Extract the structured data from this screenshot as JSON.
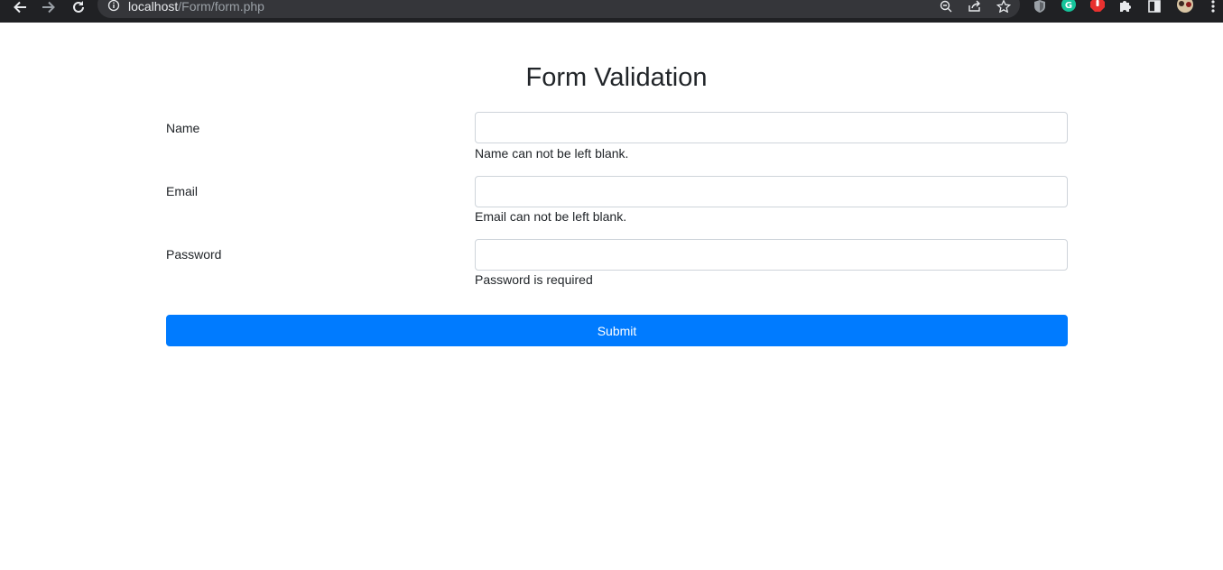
{
  "browser": {
    "url_host": "localhost",
    "url_path": "/Form/form.php",
    "icons": [
      "back-icon",
      "forward-icon",
      "reload-icon",
      "info-icon",
      "zoom-icon",
      "share-icon",
      "star-icon",
      "shield-extension-icon",
      "grammarly-icon",
      "stop-extension-icon",
      "puzzle-icon",
      "sidepanel-icon",
      "profile-avatar",
      "menu-icon"
    ],
    "colors": {
      "bar": "#202124",
      "omnibox": "#35363a",
      "grammarly": "#15c39a",
      "stop_ext": "#e8312f"
    }
  },
  "page": {
    "title": "Form Validation",
    "fields": [
      {
        "label": "Name",
        "value": "",
        "error": "Name can not be left blank."
      },
      {
        "label": "Email",
        "value": "",
        "error": "Email can not be left blank."
      },
      {
        "label": "Password",
        "value": "",
        "error": "Password is required"
      }
    ],
    "submit_label": "Submit",
    "colors": {
      "primary": "#007bff",
      "text": "#212529",
      "input_border": "#ced4da"
    }
  }
}
